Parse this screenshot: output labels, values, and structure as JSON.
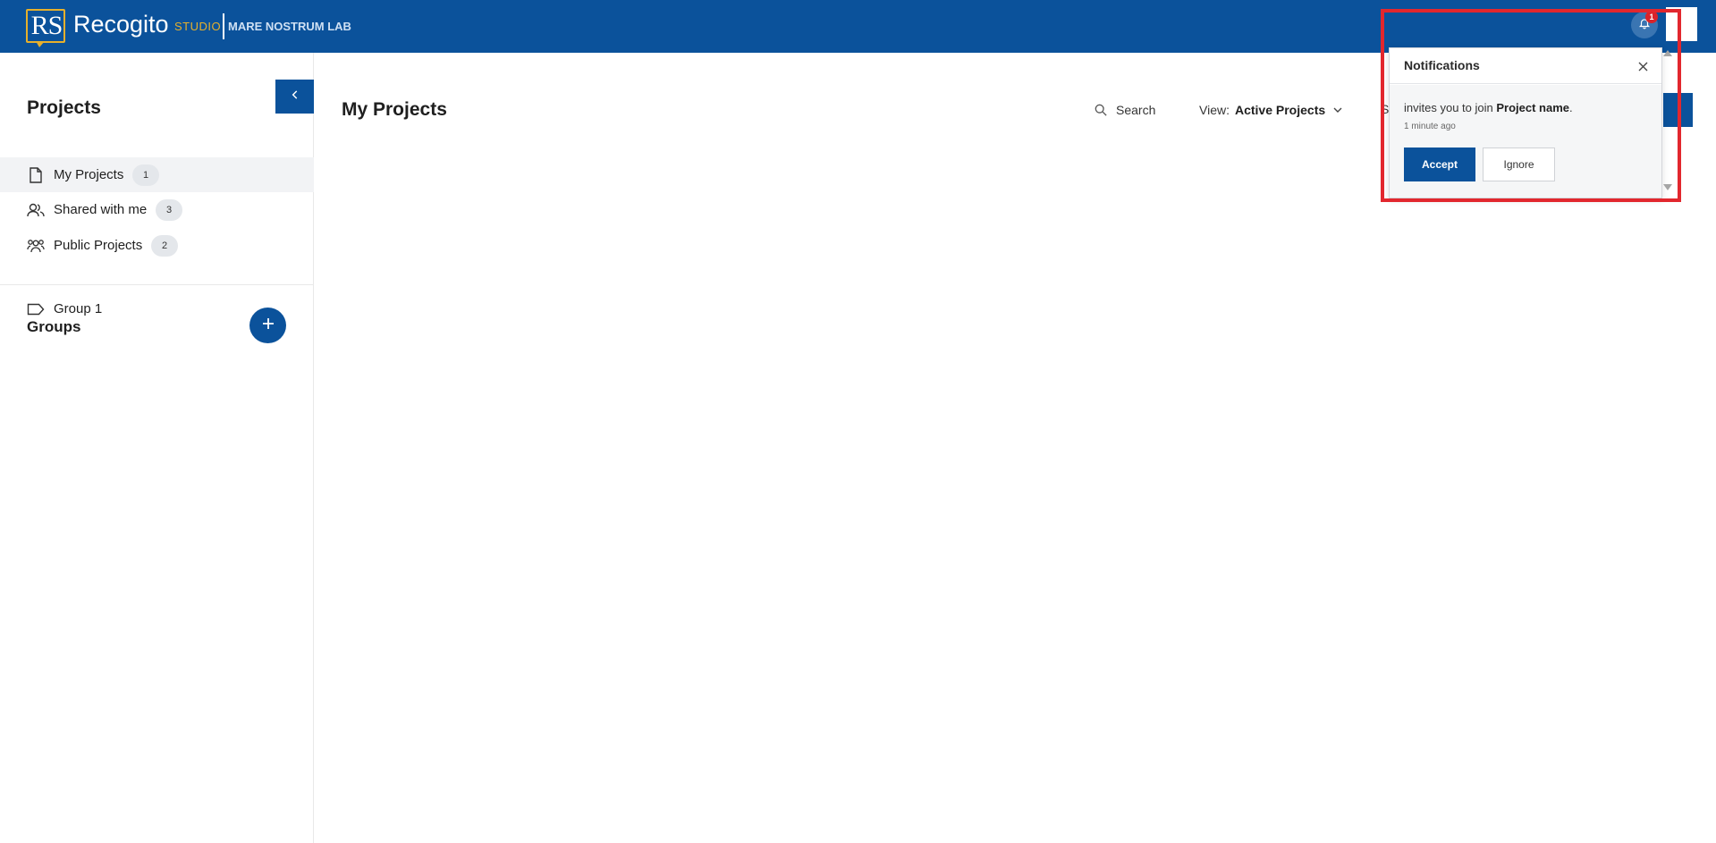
{
  "header": {
    "logo_text": "RS",
    "brand_name": "Recogito",
    "brand_suffix": "STUDIO",
    "organization": "MARE NOSTRUM LAB",
    "notification_count": "1",
    "colors": {
      "primary": "#0b529b",
      "accent": "#e6b02c",
      "badge": "#d9232a"
    }
  },
  "sidebar": {
    "title": "Projects",
    "items": [
      {
        "label": "My Projects",
        "count": "1",
        "icon": "document-icon",
        "active": true
      },
      {
        "label": "Shared with me",
        "count": "3",
        "icon": "users-icon",
        "active": false
      },
      {
        "label": "Public Projects",
        "count": "2",
        "icon": "group-icon",
        "active": false
      }
    ],
    "groups_title": "Groups",
    "groups": [
      {
        "label": "Group 1",
        "icon": "tag-icon"
      }
    ]
  },
  "main": {
    "title": "My Projects",
    "search_label": "Search",
    "view_prefix": "View:",
    "view_value": "Active Projects",
    "hidden_sort_fragment": "S"
  },
  "notifications": {
    "title": "Notifications",
    "message_prefix": "invites you to join ",
    "message_project": "Project name",
    "message_suffix": ".",
    "time": "1 minute ago",
    "accept_label": "Accept",
    "ignore_label": "Ignore"
  }
}
